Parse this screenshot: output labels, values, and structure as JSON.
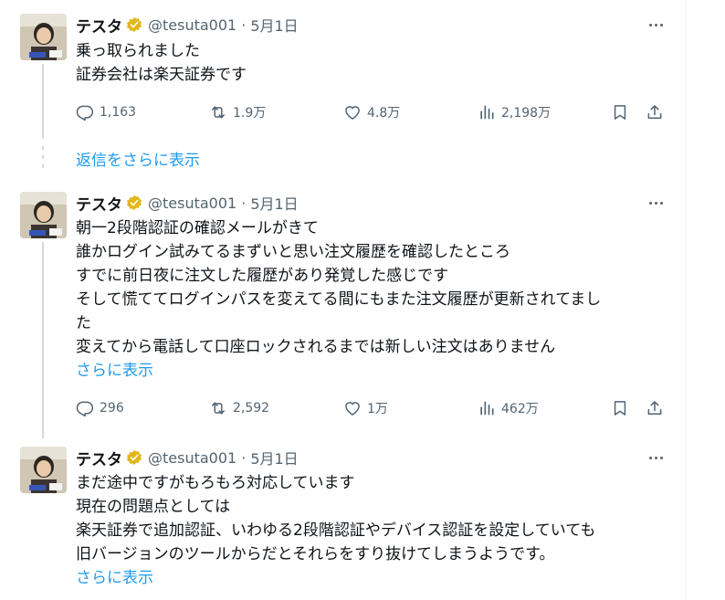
{
  "tweets": [
    {
      "name": "テスタ",
      "handle": "@tesuta001",
      "separator": "·",
      "date": "5月1日",
      "lines": [
        "乗っ取られました",
        "証券会社は楽天証券です"
      ],
      "show_more": "",
      "replies": "1,163",
      "retweets": "1.9万",
      "likes": "4.8万",
      "views": "2,198万"
    },
    {
      "name": "テスタ",
      "handle": "@tesuta001",
      "separator": "·",
      "date": "5月1日",
      "lines": [
        "朝一2段階認証の確認メールがきて",
        "誰かログイン試みてるまずいと思い注文履歴を確認したところ",
        "すでに前日夜に注文した履歴があり発覚した感じです",
        "そして慌ててログインパスを変えてる間にもまた注文履歴が更新されてまし",
        "た",
        "変えてから電話して口座ロックされるまでは新しい注文はありません"
      ],
      "show_more": "さらに表示",
      "replies": "296",
      "retweets": "2,592",
      "likes": "1万",
      "views": "462万"
    },
    {
      "name": "テスタ",
      "handle": "@tesuta001",
      "separator": "·",
      "date": "5月1日",
      "lines": [
        "まだ途中ですがもろもろ対応しています",
        "現在の問題点としては",
        "楽天証券で追加認証、いわゆる2段階認証やデバイス認証を設定していても",
        "旧バージョンのツールからだとそれらをすり抜けてしまうようです。"
      ],
      "show_more": "さらに表示",
      "replies": "",
      "retweets": "",
      "likes": "",
      "views": ""
    }
  ],
  "show_replies_label": "返信をさらに表示",
  "colors": {
    "text": "#0f1419",
    "secondary": "#536471",
    "link": "#1d9bf0",
    "verified_badge": "#e2b719",
    "thread_line": "#cfd9de"
  },
  "icons": {
    "reply": "reply-icon",
    "retweet": "retweet-icon",
    "like": "heart-icon",
    "views": "views-icon",
    "bookmark": "bookmark-icon",
    "share": "share-icon",
    "more": "more-icon",
    "badge": "verified-badge-icon"
  }
}
